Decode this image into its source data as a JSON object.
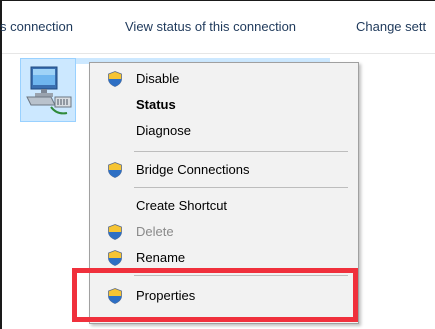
{
  "toolbar": {
    "items": [
      "s connection",
      "View status of this connection",
      "Change sett"
    ]
  },
  "context_menu": {
    "items": [
      {
        "label": "Disable",
        "shield": true,
        "bold": false,
        "disabled": false
      },
      {
        "label": "Status",
        "shield": false,
        "bold": true,
        "disabled": false
      },
      {
        "label": "Diagnose",
        "shield": false,
        "bold": false,
        "disabled": false
      },
      {
        "label": "Bridge Connections",
        "shield": true,
        "bold": false,
        "disabled": false
      },
      {
        "label": "Create Shortcut",
        "shield": false,
        "bold": false,
        "disabled": false
      },
      {
        "label": "Delete",
        "shield": true,
        "bold": false,
        "disabled": true
      },
      {
        "label": "Rename",
        "shield": true,
        "bold": false,
        "disabled": false
      },
      {
        "label": "Properties",
        "shield": true,
        "bold": false,
        "disabled": false
      }
    ]
  },
  "colors": {
    "toolbar_text": "#1e395b",
    "menu_background": "#f2f2f2",
    "selection": "#cce8ff",
    "highlight_box": "#f0303c",
    "disabled_text": "#8a8a8a"
  },
  "icons": {
    "shield": "uac-shield-icon",
    "connection": "network-adapter-icon"
  }
}
